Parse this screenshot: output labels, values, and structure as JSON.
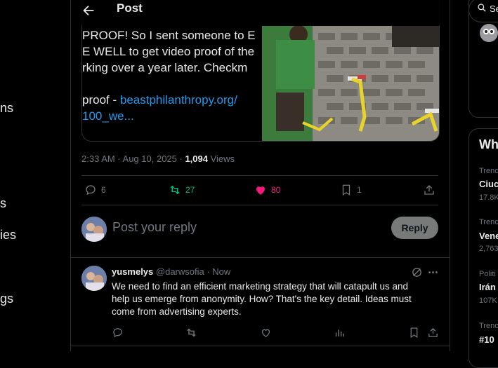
{
  "left_nav": {
    "fragments": [
      "ns",
      "s",
      "ies",
      "gs"
    ]
  },
  "header": {
    "title": "Post",
    "back_icon": "arrow-left-icon"
  },
  "embedded_card": {
    "lines": [
      "PROOF! So I sent someone to E",
      "E WELL to get video proof of the",
      "rking over a year later. Checkm"
    ],
    "link_prefix": "proof - ",
    "link_text": "beastphilanthropy.org/",
    "link_text_2": "100_we..."
  },
  "meta": {
    "time_date": "2:33 AM · Aug 10, 2025 · ",
    "views_count": "1,094",
    "views_label": " Views"
  },
  "actions": {
    "replies": "6",
    "reposts": "27",
    "likes": "80",
    "bookmarks": "1",
    "colors": {
      "repost": "#00ba7c",
      "like": "#f91880",
      "muted": "#71767b"
    }
  },
  "reply_box": {
    "placeholder": "Post your reply",
    "button": "Reply"
  },
  "reply_tweet": {
    "name": "yusmelys",
    "handle": "@darwsofia",
    "separator": " · ",
    "time": "Now",
    "text": "We need to find an efficient marketing strategy that will catapult us and help us emerge from anonymity. How? That's the key detail. Ideas must come from advertising experts."
  },
  "right_column": {
    "search_text": "Se",
    "section_title": "Wh",
    "trends": [
      {
        "label": "Trenc",
        "name": "Ciuc",
        "count": "17.8K"
      },
      {
        "label": "Trenc",
        "name": "Vene",
        "count": "2,763"
      },
      {
        "label": "Politi",
        "name": "Irán",
        "count": "107K"
      },
      {
        "label": "Trenc",
        "name": "#10",
        "count": ""
      }
    ]
  }
}
